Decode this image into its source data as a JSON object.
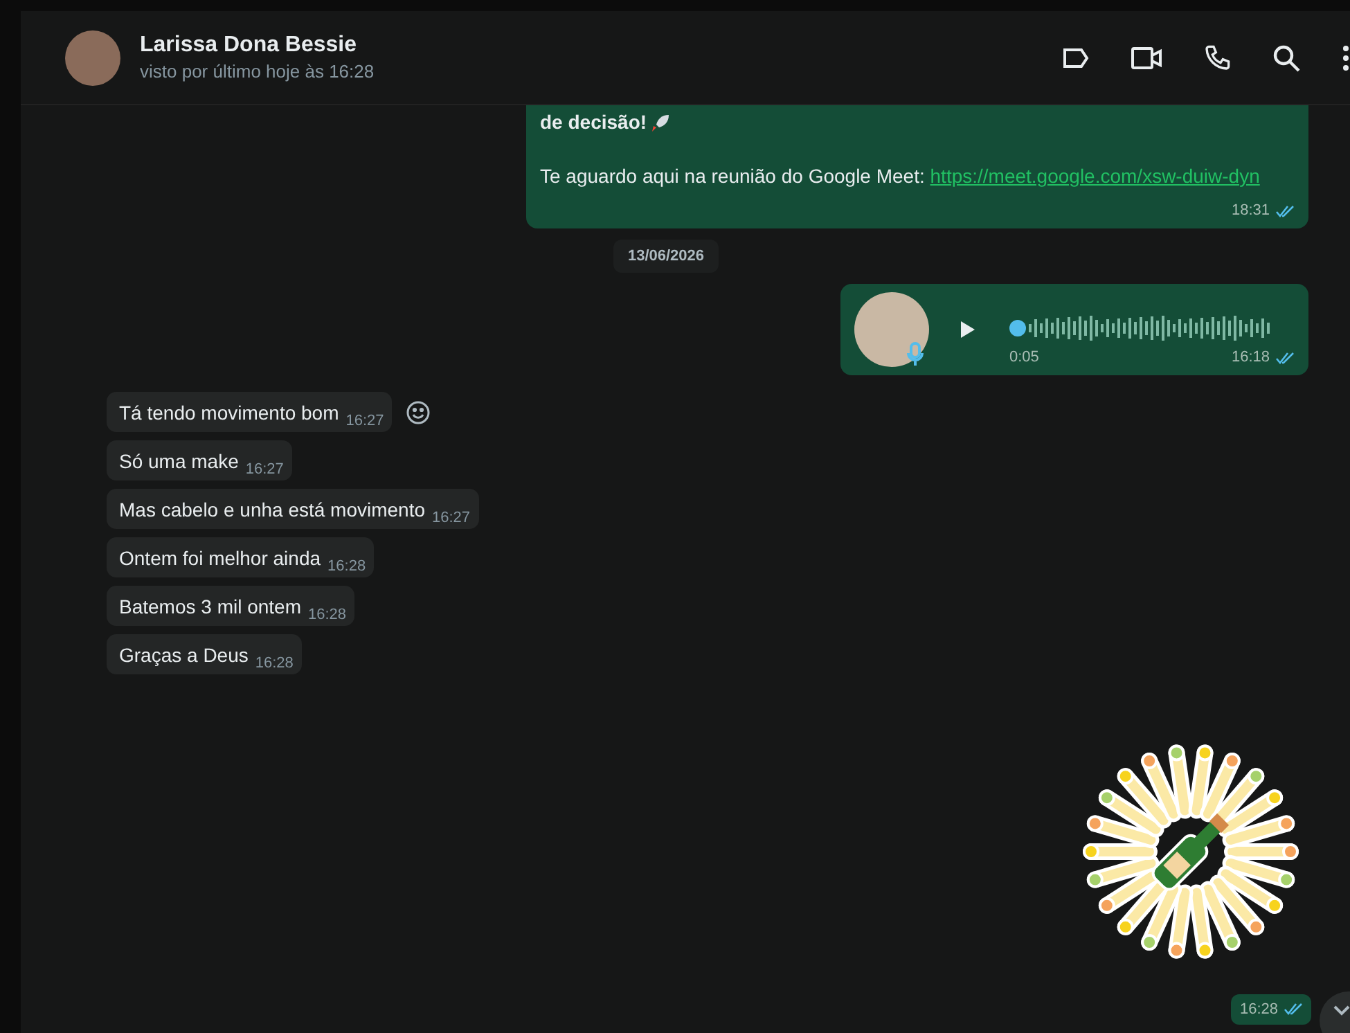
{
  "contact": {
    "name": "Larissa Dona Bessie",
    "status": "visto por último hoje às 16:28"
  },
  "timeline": [
    {
      "kind": "text_out",
      "bold_line": "de decisão!",
      "text": "Te aguardo aqui na reunião do Google Meet: ",
      "link": "https://meet.google.com/xsw-duiw-dyn",
      "time": "18:31",
      "read": true
    },
    {
      "kind": "date",
      "text": "13/06/2026"
    },
    {
      "kind": "voice_out",
      "duration": "0:05",
      "time": "16:18",
      "read": true
    },
    {
      "kind": "text_in",
      "text": "Tá tendo movimento bom",
      "time": "16:27",
      "react": true
    },
    {
      "kind": "text_in",
      "text": "Só uma make",
      "time": "16:27",
      "react": false
    },
    {
      "kind": "text_in",
      "text": "Mas cabelo e unha está movimento",
      "time": "16:27",
      "react": false
    },
    {
      "kind": "text_in",
      "text": "Ontem foi melhor ainda",
      "time": "16:28",
      "react": false
    },
    {
      "kind": "text_in",
      "text": "Batemos 3 mil ontem",
      "time": "16:28",
      "react": false
    },
    {
      "kind": "text_in",
      "text": "Graças a Deus",
      "time": "16:28",
      "react": false
    },
    {
      "kind": "sticker_out",
      "time": "16:28",
      "read": true
    }
  ]
}
